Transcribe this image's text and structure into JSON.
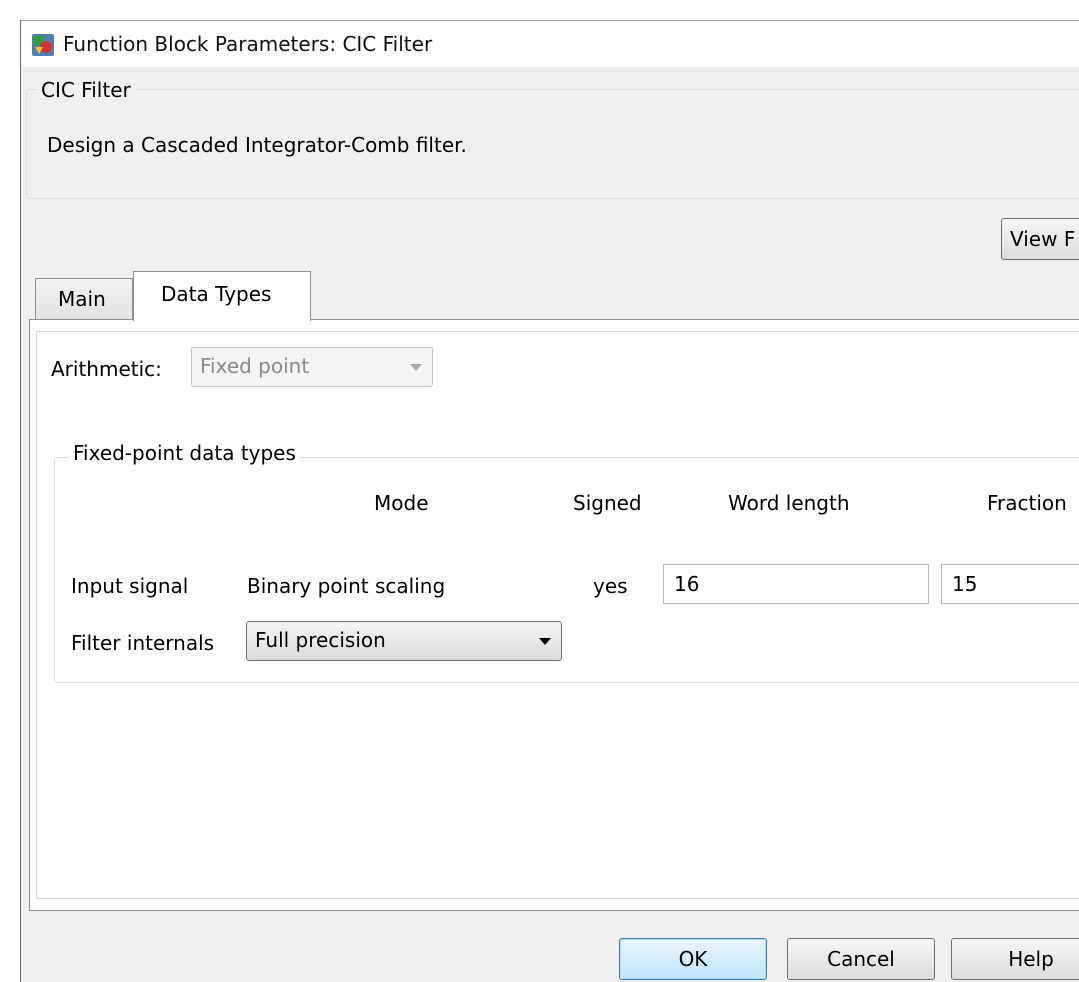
{
  "window": {
    "title": "Function Block Parameters: CIC Filter"
  },
  "description": {
    "legend": "CIC Filter",
    "text": "Design a Cascaded Integrator-Comb filter."
  },
  "view_button_label": "View F",
  "tabs": [
    {
      "label": "Main",
      "active": false
    },
    {
      "label": "Data Types",
      "active": true
    }
  ],
  "arithmetic": {
    "label": "Arithmetic:",
    "value": "Fixed point",
    "enabled": false
  },
  "fixed_point": {
    "legend": "Fixed-point data types",
    "headers": {
      "mode": "Mode",
      "signed": "Signed",
      "word_length": "Word length",
      "fraction": "Fraction"
    },
    "input_signal": {
      "label": "Input signal",
      "mode": "Binary point scaling",
      "signed": "yes",
      "word_length": "16",
      "fraction_length": "15"
    },
    "filter_internals": {
      "label": "Filter internals",
      "value": "Full precision"
    }
  },
  "buttons": {
    "ok": "OK",
    "cancel": "Cancel",
    "help": "Help"
  }
}
